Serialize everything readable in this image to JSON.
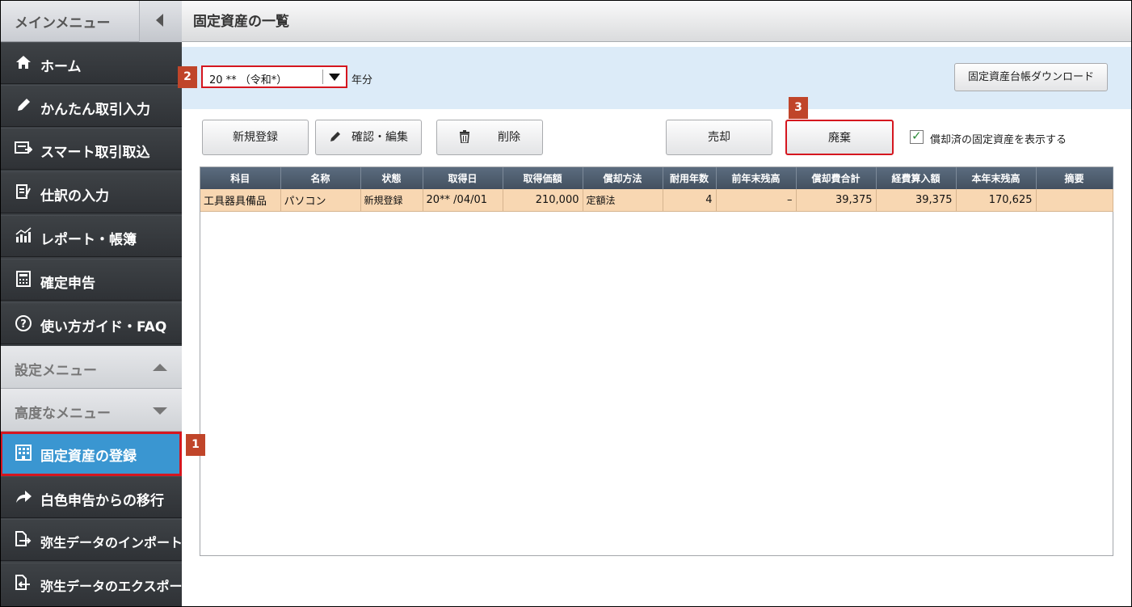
{
  "sidebar": {
    "title": "メインメニュー",
    "items": [
      {
        "label": "ホーム",
        "icon": "home-icon"
      },
      {
        "label": "かんたん取引入力",
        "icon": "pencil-icon"
      },
      {
        "label": "スマート取引取込",
        "icon": "import-icon"
      },
      {
        "label": "仕訳の入力",
        "icon": "journal-icon"
      },
      {
        "label": "レポート・帳簿",
        "icon": "report-icon"
      },
      {
        "label": "確定申告",
        "icon": "calculator-icon"
      },
      {
        "label": "使い方ガイド・FAQ",
        "icon": "help-icon"
      }
    ],
    "settings_label": "設定メニュー",
    "advanced_label": "高度なメニュー",
    "active_item": {
      "label": "固定資産の登録",
      "icon": "building-icon"
    },
    "extra_items": [
      {
        "label": "白色申告からの移行",
        "icon": "arrow-icon"
      },
      {
        "label": "弥生データのインポート",
        "icon": "import-doc-icon"
      },
      {
        "label": "弥生データのエクスポート",
        "icon": "export-doc-icon"
      }
    ]
  },
  "badges": {
    "one": "1",
    "two": "2",
    "three": "3"
  },
  "header": {
    "title": "固定資産の一覧"
  },
  "filter": {
    "year_value": "20 ** （令和*）",
    "year_suffix": "年分",
    "download_label": "固定資産台帳ダウンロード"
  },
  "actions": {
    "new_label": "新規登録",
    "edit_label": "確認・編集",
    "delete_label": "削除",
    "sell_label": "売却",
    "dispose_label": "廃棄",
    "show_depreciated_label": "償却済の固定資産を表示する",
    "show_depreciated_checked": true
  },
  "table": {
    "headers": [
      "科目",
      "名称",
      "状態",
      "取得日",
      "取得価額",
      "償却方法",
      "耐用年数",
      "前年末残高",
      "償却費合計",
      "経費算入額",
      "本年末残高",
      "摘要"
    ],
    "rows": [
      [
        "工具器具備品",
        "パソコン",
        "新規登録",
        "20** /04/01",
        "210,000",
        "定額法",
        "4",
        "–",
        "39,375",
        "39,375",
        "170,625",
        ""
      ]
    ]
  },
  "colors": {
    "sidebar_bg": "#3a3e42",
    "active_bg": "#3a96d1",
    "highlight_red": "#d5161f",
    "badge": "#c0452a",
    "row_selected": "#f8d7b2",
    "header_bg": "#4b5969"
  }
}
